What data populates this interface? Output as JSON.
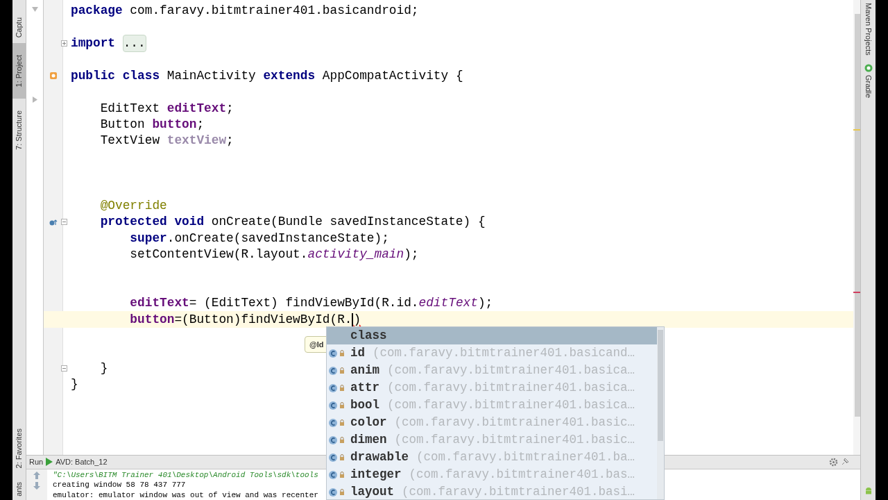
{
  "left_tool_tabs": [
    {
      "label": "Captu",
      "selected": false
    },
    {
      "label": "1: Project",
      "selected": true
    },
    {
      "label": "7: Structure",
      "selected": false
    },
    {
      "label": "2: Favorites",
      "selected": false
    },
    {
      "label": "ants",
      "selected": false
    }
  ],
  "editor": {
    "lines": [
      {
        "kind": "code",
        "tokens": [
          {
            "kind": "keyword",
            "t": "package"
          },
          {
            "kind": "plain",
            "t": " com.faravy.bitmtrainer401.basicandroid;"
          }
        ]
      },
      {
        "kind": "blank"
      },
      {
        "kind": "code",
        "fold_marker": {
          "kind": "expand"
        },
        "tokens": [
          {
            "kind": "keyword",
            "t": "import "
          },
          {
            "kind": "folded",
            "t": "..."
          }
        ]
      },
      {
        "kind": "blank"
      },
      {
        "kind": "code",
        "gutter_icon": {
          "kind": "class"
        },
        "tokens": [
          {
            "kind": "keyword",
            "t": "public class"
          },
          {
            "kind": "plain",
            "t": " MainActivity "
          },
          {
            "kind": "keyword",
            "t": "extends"
          },
          {
            "kind": "plain",
            "t": " AppCompatActivity {"
          }
        ]
      },
      {
        "kind": "blank"
      },
      {
        "kind": "code",
        "tokens": [
          {
            "kind": "plain",
            "t": "    EditText "
          },
          {
            "kind": "field",
            "t": "editText"
          },
          {
            "kind": "plain",
            "t": ";"
          }
        ]
      },
      {
        "kind": "code",
        "tokens": [
          {
            "kind": "plain",
            "t": "    Button "
          },
          {
            "kind": "field",
            "t": "button"
          },
          {
            "kind": "plain",
            "t": ";"
          }
        ]
      },
      {
        "kind": "code",
        "tokens": [
          {
            "kind": "plain",
            "t": "    TextView "
          },
          {
            "kind": "unused",
            "t": "textView"
          },
          {
            "kind": "plain",
            "t": ";"
          }
        ]
      },
      {
        "kind": "blank"
      },
      {
        "kind": "blank"
      },
      {
        "kind": "blank"
      },
      {
        "kind": "code",
        "tokens": [
          {
            "kind": "annotation",
            "t": "    @Override"
          }
        ]
      },
      {
        "kind": "code",
        "gutter_icon": {
          "kind": "override"
        },
        "fold_marker": {
          "kind": "collapse"
        },
        "tokens": [
          {
            "kind": "keyword",
            "t": "    protected void"
          },
          {
            "kind": "plain",
            "t": " onCreate(Bundle savedInstanceState) {"
          }
        ]
      },
      {
        "kind": "code",
        "tokens": [
          {
            "kind": "keyword",
            "t": "        super"
          },
          {
            "kind": "plain",
            "t": ".onCreate(savedInstanceState);"
          }
        ]
      },
      {
        "kind": "code",
        "tokens": [
          {
            "kind": "plain",
            "t": "        setContentView(R.layout."
          },
          {
            "kind": "static",
            "t": "activity_main"
          },
          {
            "kind": "plain",
            "t": ");"
          }
        ]
      },
      {
        "kind": "blank"
      },
      {
        "kind": "blank"
      },
      {
        "kind": "code",
        "tokens": [
          {
            "kind": "field",
            "t": "        editText"
          },
          {
            "kind": "plain",
            "t": "= (EditText) findViewById(R.id."
          },
          {
            "kind": "static",
            "t": "editText"
          },
          {
            "kind": "plain",
            "t": ");"
          }
        ]
      },
      {
        "kind": "code",
        "current": true,
        "caret": true,
        "tokens": [
          {
            "kind": "field",
            "t": "        button"
          },
          {
            "kind": "plain",
            "t": "=(Button)findViewById(R."
          },
          {
            "kind": "error",
            "t": ")"
          }
        ]
      },
      {
        "kind": "blank"
      },
      {
        "kind": "blank"
      },
      {
        "kind": "code",
        "fold_marker": {
          "kind": "end"
        },
        "tokens": [
          {
            "kind": "plain",
            "t": "    }"
          }
        ]
      },
      {
        "kind": "code",
        "tokens": [
          {
            "kind": "plain",
            "t": "}"
          }
        ]
      }
    ]
  },
  "tooltip": {
    "text": "@Id"
  },
  "autocomplete": {
    "items": [
      {
        "kind": "keyword",
        "name": "class",
        "selected": true
      },
      {
        "kind": "inner_class",
        "name": "id",
        "detail": "(com.faravy.bitmtrainer401.basicand…",
        "selected": false
      },
      {
        "kind": "inner_class",
        "name": "anim",
        "detail": "(com.faravy.bitmtrainer401.basica…",
        "selected": false
      },
      {
        "kind": "inner_class",
        "name": "attr",
        "detail": "(com.faravy.bitmtrainer401.basica…",
        "selected": false
      },
      {
        "kind": "inner_class",
        "name": "bool",
        "detail": "(com.faravy.bitmtrainer401.basica…",
        "selected": false
      },
      {
        "kind": "inner_class",
        "name": "color",
        "detail": "(com.faravy.bitmtrainer401.basic…",
        "selected": false
      },
      {
        "kind": "inner_class",
        "name": "dimen",
        "detail": "(com.faravy.bitmtrainer401.basic…",
        "selected": false
      },
      {
        "kind": "inner_class",
        "name": "drawable",
        "detail": "(com.faravy.bitmtrainer401.ba…",
        "selected": false
      },
      {
        "kind": "inner_class",
        "name": "integer",
        "detail": "(com.faravy.bitmtrainer401.bas…",
        "selected": false
      },
      {
        "kind": "inner_class",
        "name": "layout",
        "detail": "(com.faravy.bitmtrainer401.basi…",
        "selected": false
      }
    ]
  },
  "run_panel": {
    "title": "Run",
    "config": "AVD: Batch_12",
    "console": [
      {
        "kind": "command",
        "text": "\"C:\\Users\\BITM Trainer 401\\Desktop\\Android Tools\\sdk\\tools"
      },
      {
        "kind": "output",
        "text": "creating window 58 78 437 777"
      },
      {
        "kind": "output",
        "text": "emulator: emulator window was out of view and was recenter"
      }
    ]
  },
  "right_tool_tabs": [
    {
      "label": "Maven Projects"
    },
    {
      "label": "Gradle"
    }
  ]
}
